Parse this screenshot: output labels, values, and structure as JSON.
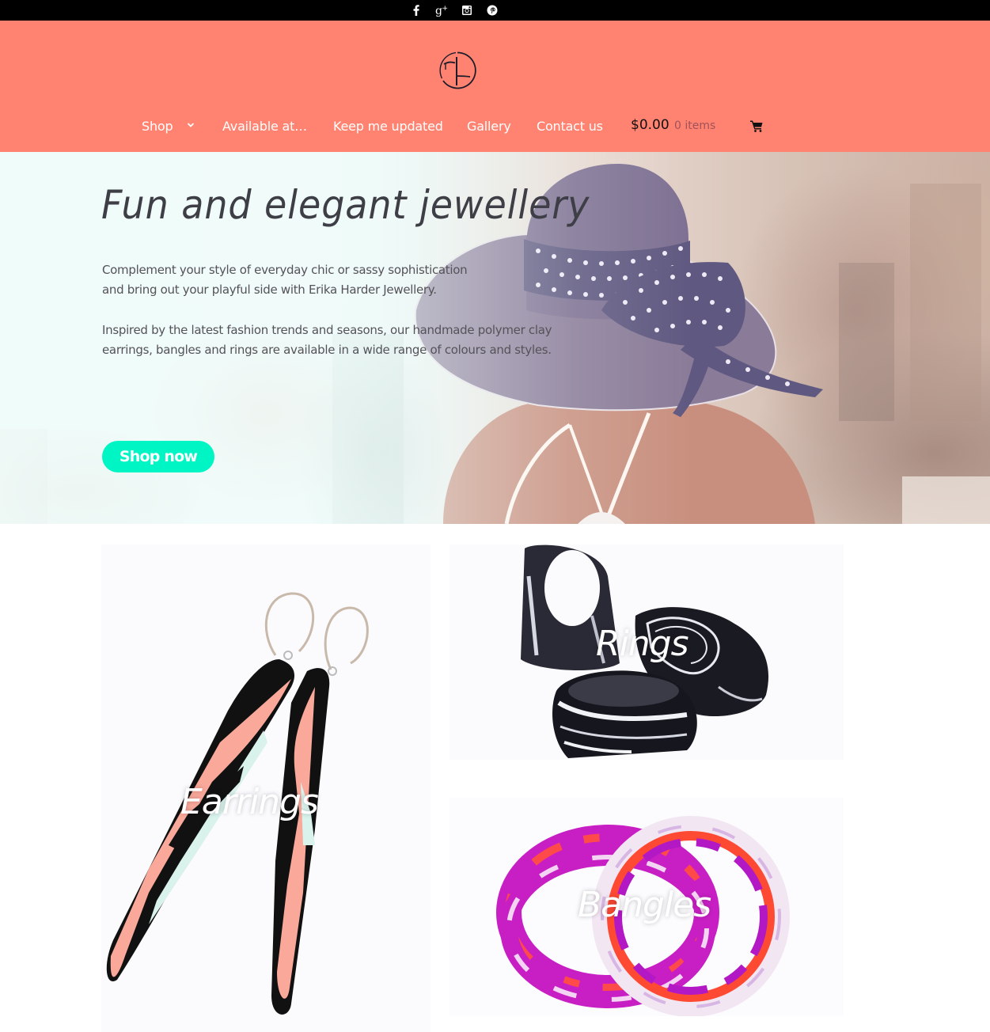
{
  "social_bar": {
    "links": [
      {
        "name": "facebook",
        "icon": "facebook-icon",
        "glyph": "f"
      },
      {
        "name": "google-plus",
        "icon": "google-plus-icon",
        "glyph": "g+"
      },
      {
        "name": "instagram",
        "icon": "instagram-icon",
        "glyph": "instagram"
      },
      {
        "name": "pinterest",
        "icon": "pinterest-icon",
        "glyph": "p"
      }
    ]
  },
  "header": {
    "logo_alt": "Erika Harder Jewellery logo",
    "background_color": "#ff8370",
    "nav": [
      {
        "label": "Shop",
        "has_dropdown": true
      },
      {
        "label": "Available at…",
        "has_dropdown": false
      },
      {
        "label": "Keep me updated",
        "has_dropdown": false
      },
      {
        "label": "Gallery",
        "has_dropdown": false
      },
      {
        "label": "Contact us",
        "has_dropdown": false
      }
    ],
    "cart": {
      "amount": "$0.00",
      "items": "0 items",
      "icon": "shopping-cart-icon"
    }
  },
  "hero": {
    "title": "Fun and elegant jewellery",
    "paragraph_1": "Complement your style of everyday chic or sassy sophistication and bring out your playful side with Erika Harder Jewellery.",
    "paragraph_2": "Inspired by the latest fashion trends and seasons, our handmade polymer clay earrings,  bangles and rings are available in a wide range of colours and styles.",
    "cta_label": "Shop now",
    "cta_color": "#00f5c4"
  },
  "categories": [
    {
      "label": "Earrings"
    },
    {
      "label": "Rings"
    },
    {
      "label": "Bangles"
    }
  ]
}
